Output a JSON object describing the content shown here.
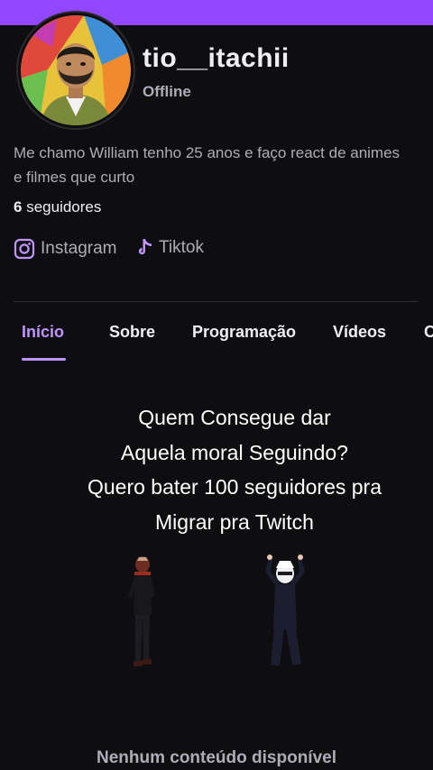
{
  "profile": {
    "username": "tio__itachii",
    "status": "Offline",
    "bio": "Me chamo William tenho 25 anos e faço react de animes e filmes que curto",
    "followers_count": "6",
    "followers_label": "seguidores"
  },
  "social": [
    {
      "label": "Instagram",
      "icon": "instagram-icon"
    },
    {
      "label": "Tiktok",
      "icon": "tiktok-icon"
    }
  ],
  "tabs": [
    {
      "label": "Início",
      "active": true
    },
    {
      "label": "Sobre",
      "active": false
    },
    {
      "label": "Programação",
      "active": false
    },
    {
      "label": "Vídeos",
      "active": false
    },
    {
      "label": "C",
      "active": false
    }
  ],
  "caption": {
    "lines": [
      "Quem Consegue dar",
      "Aquela moral Seguindo?",
      "Quero bater 100 seguidores pra",
      "Migrar pra Twitch"
    ]
  },
  "empty_state": "Nenhum conteúdo disponível",
  "colors": {
    "accent": "#9147ff",
    "active_tab": "#bf94ff",
    "background": "#0e0e10"
  }
}
